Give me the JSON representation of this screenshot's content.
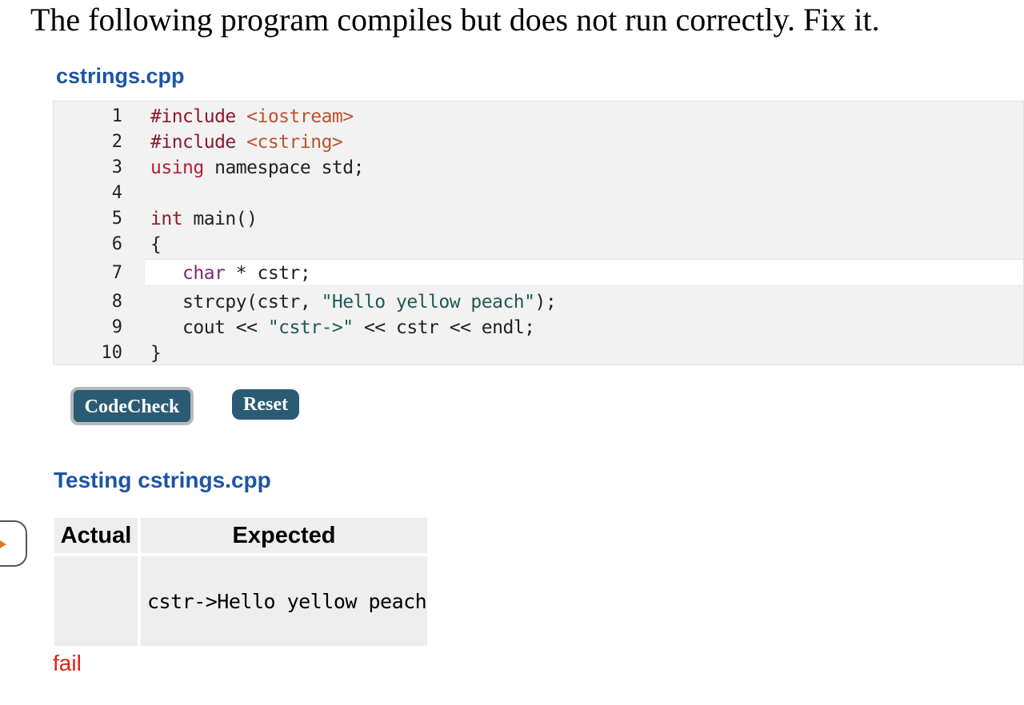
{
  "instructions": "The following program compiles but does not run correctly. Fix it.",
  "editor": {
    "filename": "cstrings.cpp",
    "active_line": 7,
    "lines": [
      {
        "n": "1",
        "text": "#include <iostream>"
      },
      {
        "n": "2",
        "text": "#include <cstring>"
      },
      {
        "n": "3",
        "text": "using namespace std;"
      },
      {
        "n": "4",
        "text": ""
      },
      {
        "n": "5",
        "text": "int main()"
      },
      {
        "n": "6",
        "text": "{"
      },
      {
        "n": "7",
        "text": "   char * cstr;"
      },
      {
        "n": "8",
        "text": "   strcpy(cstr, \"Hello yellow peach\");"
      },
      {
        "n": "9",
        "text": "   cout << \"cstr->\" << cstr << endl;"
      },
      {
        "n": "10",
        "text": "}"
      }
    ]
  },
  "buttons": {
    "codecheck": "CodeCheck",
    "reset": "Reset"
  },
  "testing": {
    "title": "Testing cstrings.cpp",
    "headers": {
      "actual": "Actual",
      "expected": "Expected"
    },
    "row": {
      "actual": "",
      "expected": "cstr->Hello yellow peach"
    },
    "verdict": "fail"
  },
  "colors": {
    "title_blue": "#1d55a6",
    "button": "#2a5b75",
    "fail_red": "#e0201c",
    "side_arrow": "#e07a1a"
  },
  "icons": {
    "side_tab": "play-arrow-icon"
  }
}
